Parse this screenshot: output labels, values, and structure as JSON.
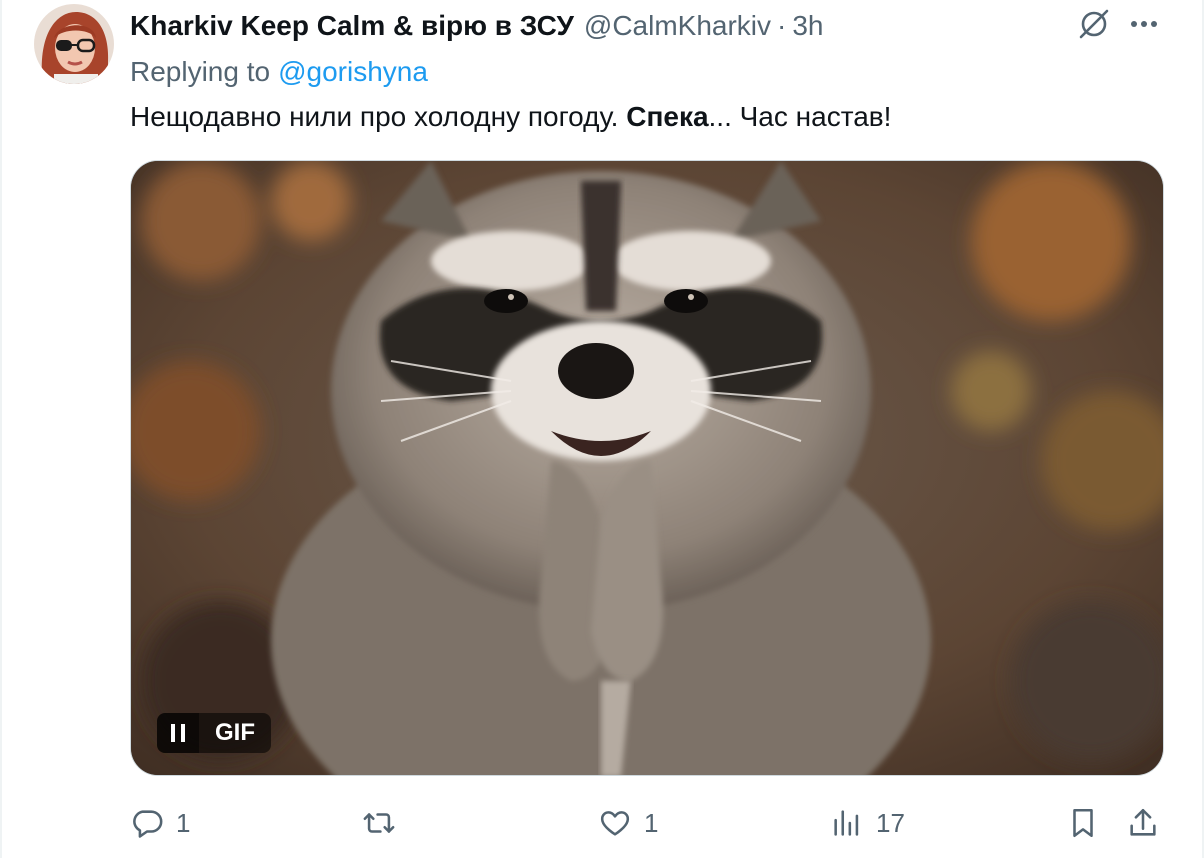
{
  "tweet": {
    "display_name": "Kharkiv Keep Calm & вірю в ЗСУ",
    "handle": "@CalmKharkiv",
    "separator": "·",
    "time": "3h",
    "replying_prefix": "Replying to",
    "replying_to": "@gorishyna",
    "text_before": "Нещодавно нили про холодну погоду. ",
    "text_bold": "Спека",
    "text_after": "... Час настав!"
  },
  "media": {
    "type_badge": "GIF",
    "state": "playing"
  },
  "actions": {
    "replies": "1",
    "retweets": "",
    "likes": "1",
    "views": "17"
  },
  "colors": {
    "accent": "#1d9bf0",
    "secondary_text": "#536471",
    "primary_text": "#0f1419"
  },
  "icons": {
    "header": [
      "grok-icon",
      "more-icon"
    ],
    "actions": [
      "reply-icon",
      "retweet-icon",
      "like-icon",
      "views-icon",
      "bookmark-icon",
      "share-icon"
    ]
  }
}
